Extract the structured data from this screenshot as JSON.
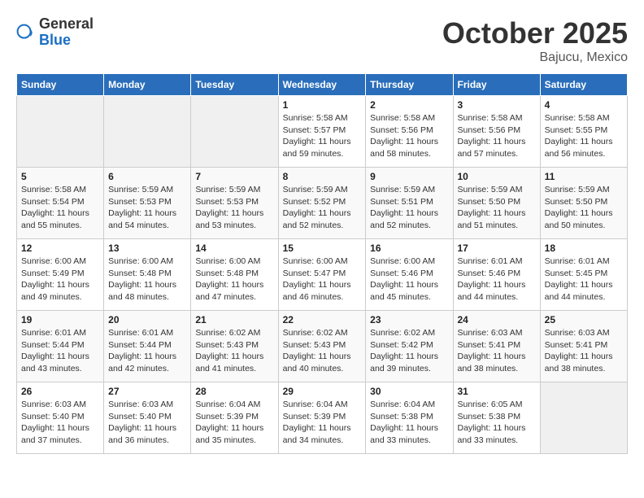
{
  "header": {
    "logo_general": "General",
    "logo_blue": "Blue",
    "month": "October 2025",
    "location": "Bajucu, Mexico"
  },
  "days_of_week": [
    "Sunday",
    "Monday",
    "Tuesday",
    "Wednesday",
    "Thursday",
    "Friday",
    "Saturday"
  ],
  "weeks": [
    [
      {
        "day": "",
        "info": ""
      },
      {
        "day": "",
        "info": ""
      },
      {
        "day": "",
        "info": ""
      },
      {
        "day": "1",
        "info": "Sunrise: 5:58 AM\nSunset: 5:57 PM\nDaylight: 11 hours\nand 59 minutes."
      },
      {
        "day": "2",
        "info": "Sunrise: 5:58 AM\nSunset: 5:56 PM\nDaylight: 11 hours\nand 58 minutes."
      },
      {
        "day": "3",
        "info": "Sunrise: 5:58 AM\nSunset: 5:56 PM\nDaylight: 11 hours\nand 57 minutes."
      },
      {
        "day": "4",
        "info": "Sunrise: 5:58 AM\nSunset: 5:55 PM\nDaylight: 11 hours\nand 56 minutes."
      }
    ],
    [
      {
        "day": "5",
        "info": "Sunrise: 5:58 AM\nSunset: 5:54 PM\nDaylight: 11 hours\nand 55 minutes."
      },
      {
        "day": "6",
        "info": "Sunrise: 5:59 AM\nSunset: 5:53 PM\nDaylight: 11 hours\nand 54 minutes."
      },
      {
        "day": "7",
        "info": "Sunrise: 5:59 AM\nSunset: 5:53 PM\nDaylight: 11 hours\nand 53 minutes."
      },
      {
        "day": "8",
        "info": "Sunrise: 5:59 AM\nSunset: 5:52 PM\nDaylight: 11 hours\nand 52 minutes."
      },
      {
        "day": "9",
        "info": "Sunrise: 5:59 AM\nSunset: 5:51 PM\nDaylight: 11 hours\nand 52 minutes."
      },
      {
        "day": "10",
        "info": "Sunrise: 5:59 AM\nSunset: 5:50 PM\nDaylight: 11 hours\nand 51 minutes."
      },
      {
        "day": "11",
        "info": "Sunrise: 5:59 AM\nSunset: 5:50 PM\nDaylight: 11 hours\nand 50 minutes."
      }
    ],
    [
      {
        "day": "12",
        "info": "Sunrise: 6:00 AM\nSunset: 5:49 PM\nDaylight: 11 hours\nand 49 minutes."
      },
      {
        "day": "13",
        "info": "Sunrise: 6:00 AM\nSunset: 5:48 PM\nDaylight: 11 hours\nand 48 minutes."
      },
      {
        "day": "14",
        "info": "Sunrise: 6:00 AM\nSunset: 5:48 PM\nDaylight: 11 hours\nand 47 minutes."
      },
      {
        "day": "15",
        "info": "Sunrise: 6:00 AM\nSunset: 5:47 PM\nDaylight: 11 hours\nand 46 minutes."
      },
      {
        "day": "16",
        "info": "Sunrise: 6:00 AM\nSunset: 5:46 PM\nDaylight: 11 hours\nand 45 minutes."
      },
      {
        "day": "17",
        "info": "Sunrise: 6:01 AM\nSunset: 5:46 PM\nDaylight: 11 hours\nand 44 minutes."
      },
      {
        "day": "18",
        "info": "Sunrise: 6:01 AM\nSunset: 5:45 PM\nDaylight: 11 hours\nand 44 minutes."
      }
    ],
    [
      {
        "day": "19",
        "info": "Sunrise: 6:01 AM\nSunset: 5:44 PM\nDaylight: 11 hours\nand 43 minutes."
      },
      {
        "day": "20",
        "info": "Sunrise: 6:01 AM\nSunset: 5:44 PM\nDaylight: 11 hours\nand 42 minutes."
      },
      {
        "day": "21",
        "info": "Sunrise: 6:02 AM\nSunset: 5:43 PM\nDaylight: 11 hours\nand 41 minutes."
      },
      {
        "day": "22",
        "info": "Sunrise: 6:02 AM\nSunset: 5:43 PM\nDaylight: 11 hours\nand 40 minutes."
      },
      {
        "day": "23",
        "info": "Sunrise: 6:02 AM\nSunset: 5:42 PM\nDaylight: 11 hours\nand 39 minutes."
      },
      {
        "day": "24",
        "info": "Sunrise: 6:03 AM\nSunset: 5:41 PM\nDaylight: 11 hours\nand 38 minutes."
      },
      {
        "day": "25",
        "info": "Sunrise: 6:03 AM\nSunset: 5:41 PM\nDaylight: 11 hours\nand 38 minutes."
      }
    ],
    [
      {
        "day": "26",
        "info": "Sunrise: 6:03 AM\nSunset: 5:40 PM\nDaylight: 11 hours\nand 37 minutes."
      },
      {
        "day": "27",
        "info": "Sunrise: 6:03 AM\nSunset: 5:40 PM\nDaylight: 11 hours\nand 36 minutes."
      },
      {
        "day": "28",
        "info": "Sunrise: 6:04 AM\nSunset: 5:39 PM\nDaylight: 11 hours\nand 35 minutes."
      },
      {
        "day": "29",
        "info": "Sunrise: 6:04 AM\nSunset: 5:39 PM\nDaylight: 11 hours\nand 34 minutes."
      },
      {
        "day": "30",
        "info": "Sunrise: 6:04 AM\nSunset: 5:38 PM\nDaylight: 11 hours\nand 33 minutes."
      },
      {
        "day": "31",
        "info": "Sunrise: 6:05 AM\nSunset: 5:38 PM\nDaylight: 11 hours\nand 33 minutes."
      },
      {
        "day": "",
        "info": ""
      }
    ]
  ]
}
